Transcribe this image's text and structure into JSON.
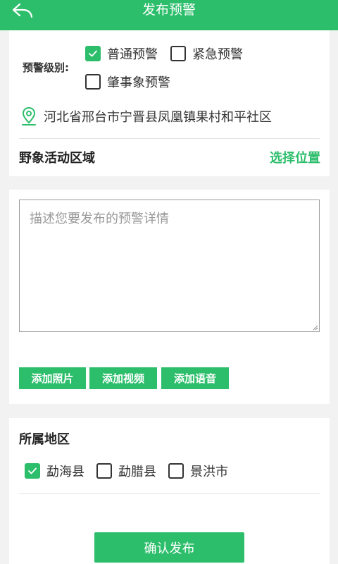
{
  "header": {
    "title": "发布预警",
    "back_icon": "back-arrow-icon"
  },
  "warning": {
    "label": "预警级别:",
    "options": [
      {
        "label": "普通预警",
        "checked": true
      },
      {
        "label": "紧急预警",
        "checked": false
      },
      {
        "label": "肇事象预警",
        "checked": false
      }
    ]
  },
  "location": {
    "icon": "location-pin-icon",
    "text": "河北省邢台市宁晋县凤凰镇果村和平社区"
  },
  "area": {
    "label": "野象活动区域",
    "action": "选择位置"
  },
  "description": {
    "placeholder": "描述您要发布的预警详情",
    "value": ""
  },
  "media": {
    "photo": "添加照片",
    "video": "添加视频",
    "audio": "添加语音"
  },
  "region": {
    "label": "所属地区",
    "options": [
      {
        "label": "勐海县",
        "checked": true
      },
      {
        "label": "勐腊县",
        "checked": false
      },
      {
        "label": "景洪市",
        "checked": false
      }
    ]
  },
  "submit": {
    "label": "确认发布"
  },
  "colors": {
    "accent": "#2dbe6c",
    "background": "#f2f2f2"
  }
}
